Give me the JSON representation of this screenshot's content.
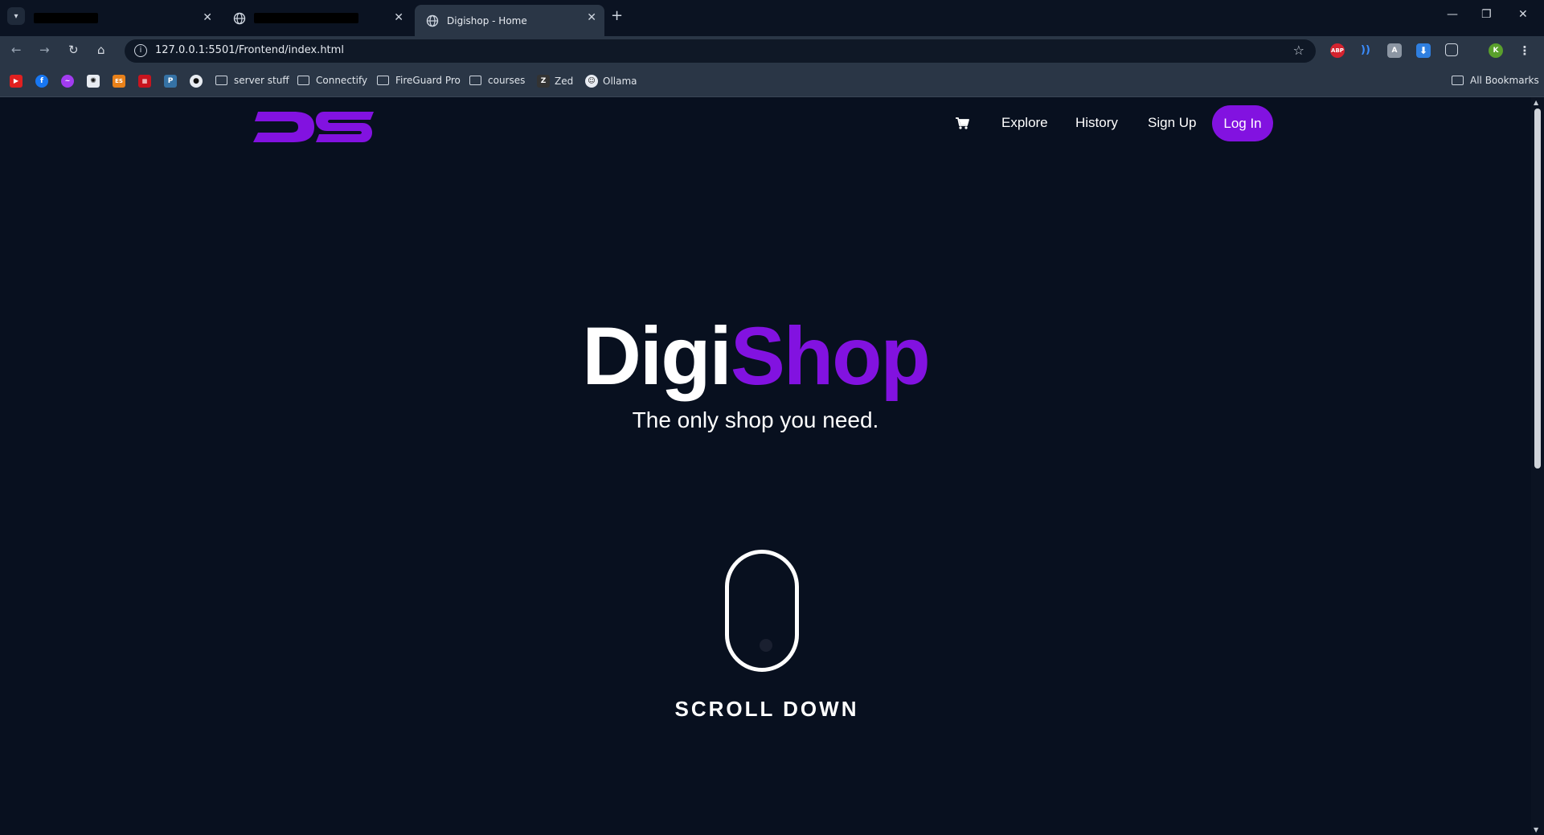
{
  "browser": {
    "tabs": [
      {
        "title": "",
        "redacted": true
      },
      {
        "title": "",
        "redacted": true
      },
      {
        "title": "Digishop - Home",
        "active": true
      }
    ],
    "url": "127.0.0.1:5501/Frontend/index.html",
    "profile_initial": "K",
    "bookmarks": [
      {
        "label": "server stuff",
        "type": "folder"
      },
      {
        "label": "Connectify",
        "type": "folder"
      },
      {
        "label": "FireGuard Pro",
        "type": "folder"
      },
      {
        "label": "courses",
        "type": "folder"
      },
      {
        "label": "Zed",
        "type": "link"
      },
      {
        "label": "Ollama",
        "type": "link"
      }
    ],
    "all_bookmarks_label": "All Bookmarks"
  },
  "site": {
    "logo_text": "DS",
    "nav": {
      "explore": "Explore",
      "history": "History",
      "signup": "Sign Up",
      "login": "Log In"
    },
    "hero": {
      "title_part1": "Digi",
      "title_part2": "Shop",
      "subtitle": "The only shop you need."
    },
    "scroll_label": "SCROLL DOWN"
  },
  "colors": {
    "background": "#08101f",
    "accent": "#8212e0",
    "text": "#ffffff"
  }
}
